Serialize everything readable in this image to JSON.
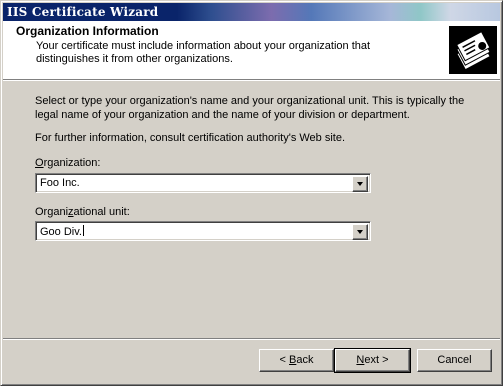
{
  "window": {
    "title": "IIS Certificate Wizard"
  },
  "header": {
    "title": "Organization Information",
    "subtitle": "Your certificate must include information about your organization that distinguishes it from other organizations.",
    "icon": "certificate-icon"
  },
  "body": {
    "instructions": "Select or type your organization's name and your organizational unit. This is typically the legal name of your organization and the name of your division or department.",
    "further_info": "For further information, consult certification authority's Web site."
  },
  "fields": {
    "organization": {
      "label_mnemonic": "O",
      "label_rest": "rganization:",
      "value": "Foo Inc."
    },
    "unit": {
      "label_pre": "Organi",
      "label_mnemonic": "z",
      "label_rest": "ational unit:",
      "value": "Goo Div."
    }
  },
  "buttons": {
    "back": {
      "arrow": "<",
      "mnemonic": "B",
      "rest": "ack"
    },
    "next": {
      "mnemonic": "N",
      "rest": "ext",
      "arrow": ">"
    },
    "cancel": {
      "label": "Cancel"
    }
  }
}
